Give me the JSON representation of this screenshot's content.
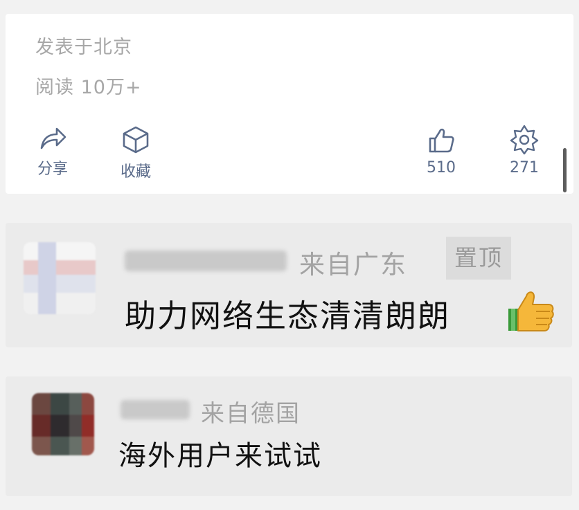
{
  "post": {
    "location": "发表于北京",
    "reads": "阅读 10万+"
  },
  "actions": {
    "share_label": "分享",
    "favorite_label": "收藏",
    "like_count": "510",
    "wow_count": "271"
  },
  "comments": [
    {
      "location": "来自广东",
      "badge": "置顶",
      "text": "助力网络生态清清朗朗",
      "emoji": "thumbs-up"
    },
    {
      "location": "来自德国",
      "text": "海外用户来试试"
    }
  ],
  "colors": {
    "action_blue": "#5a6b8a",
    "meta_gray": "#a7a7a7",
    "comment_bg": "#ebebeb"
  }
}
